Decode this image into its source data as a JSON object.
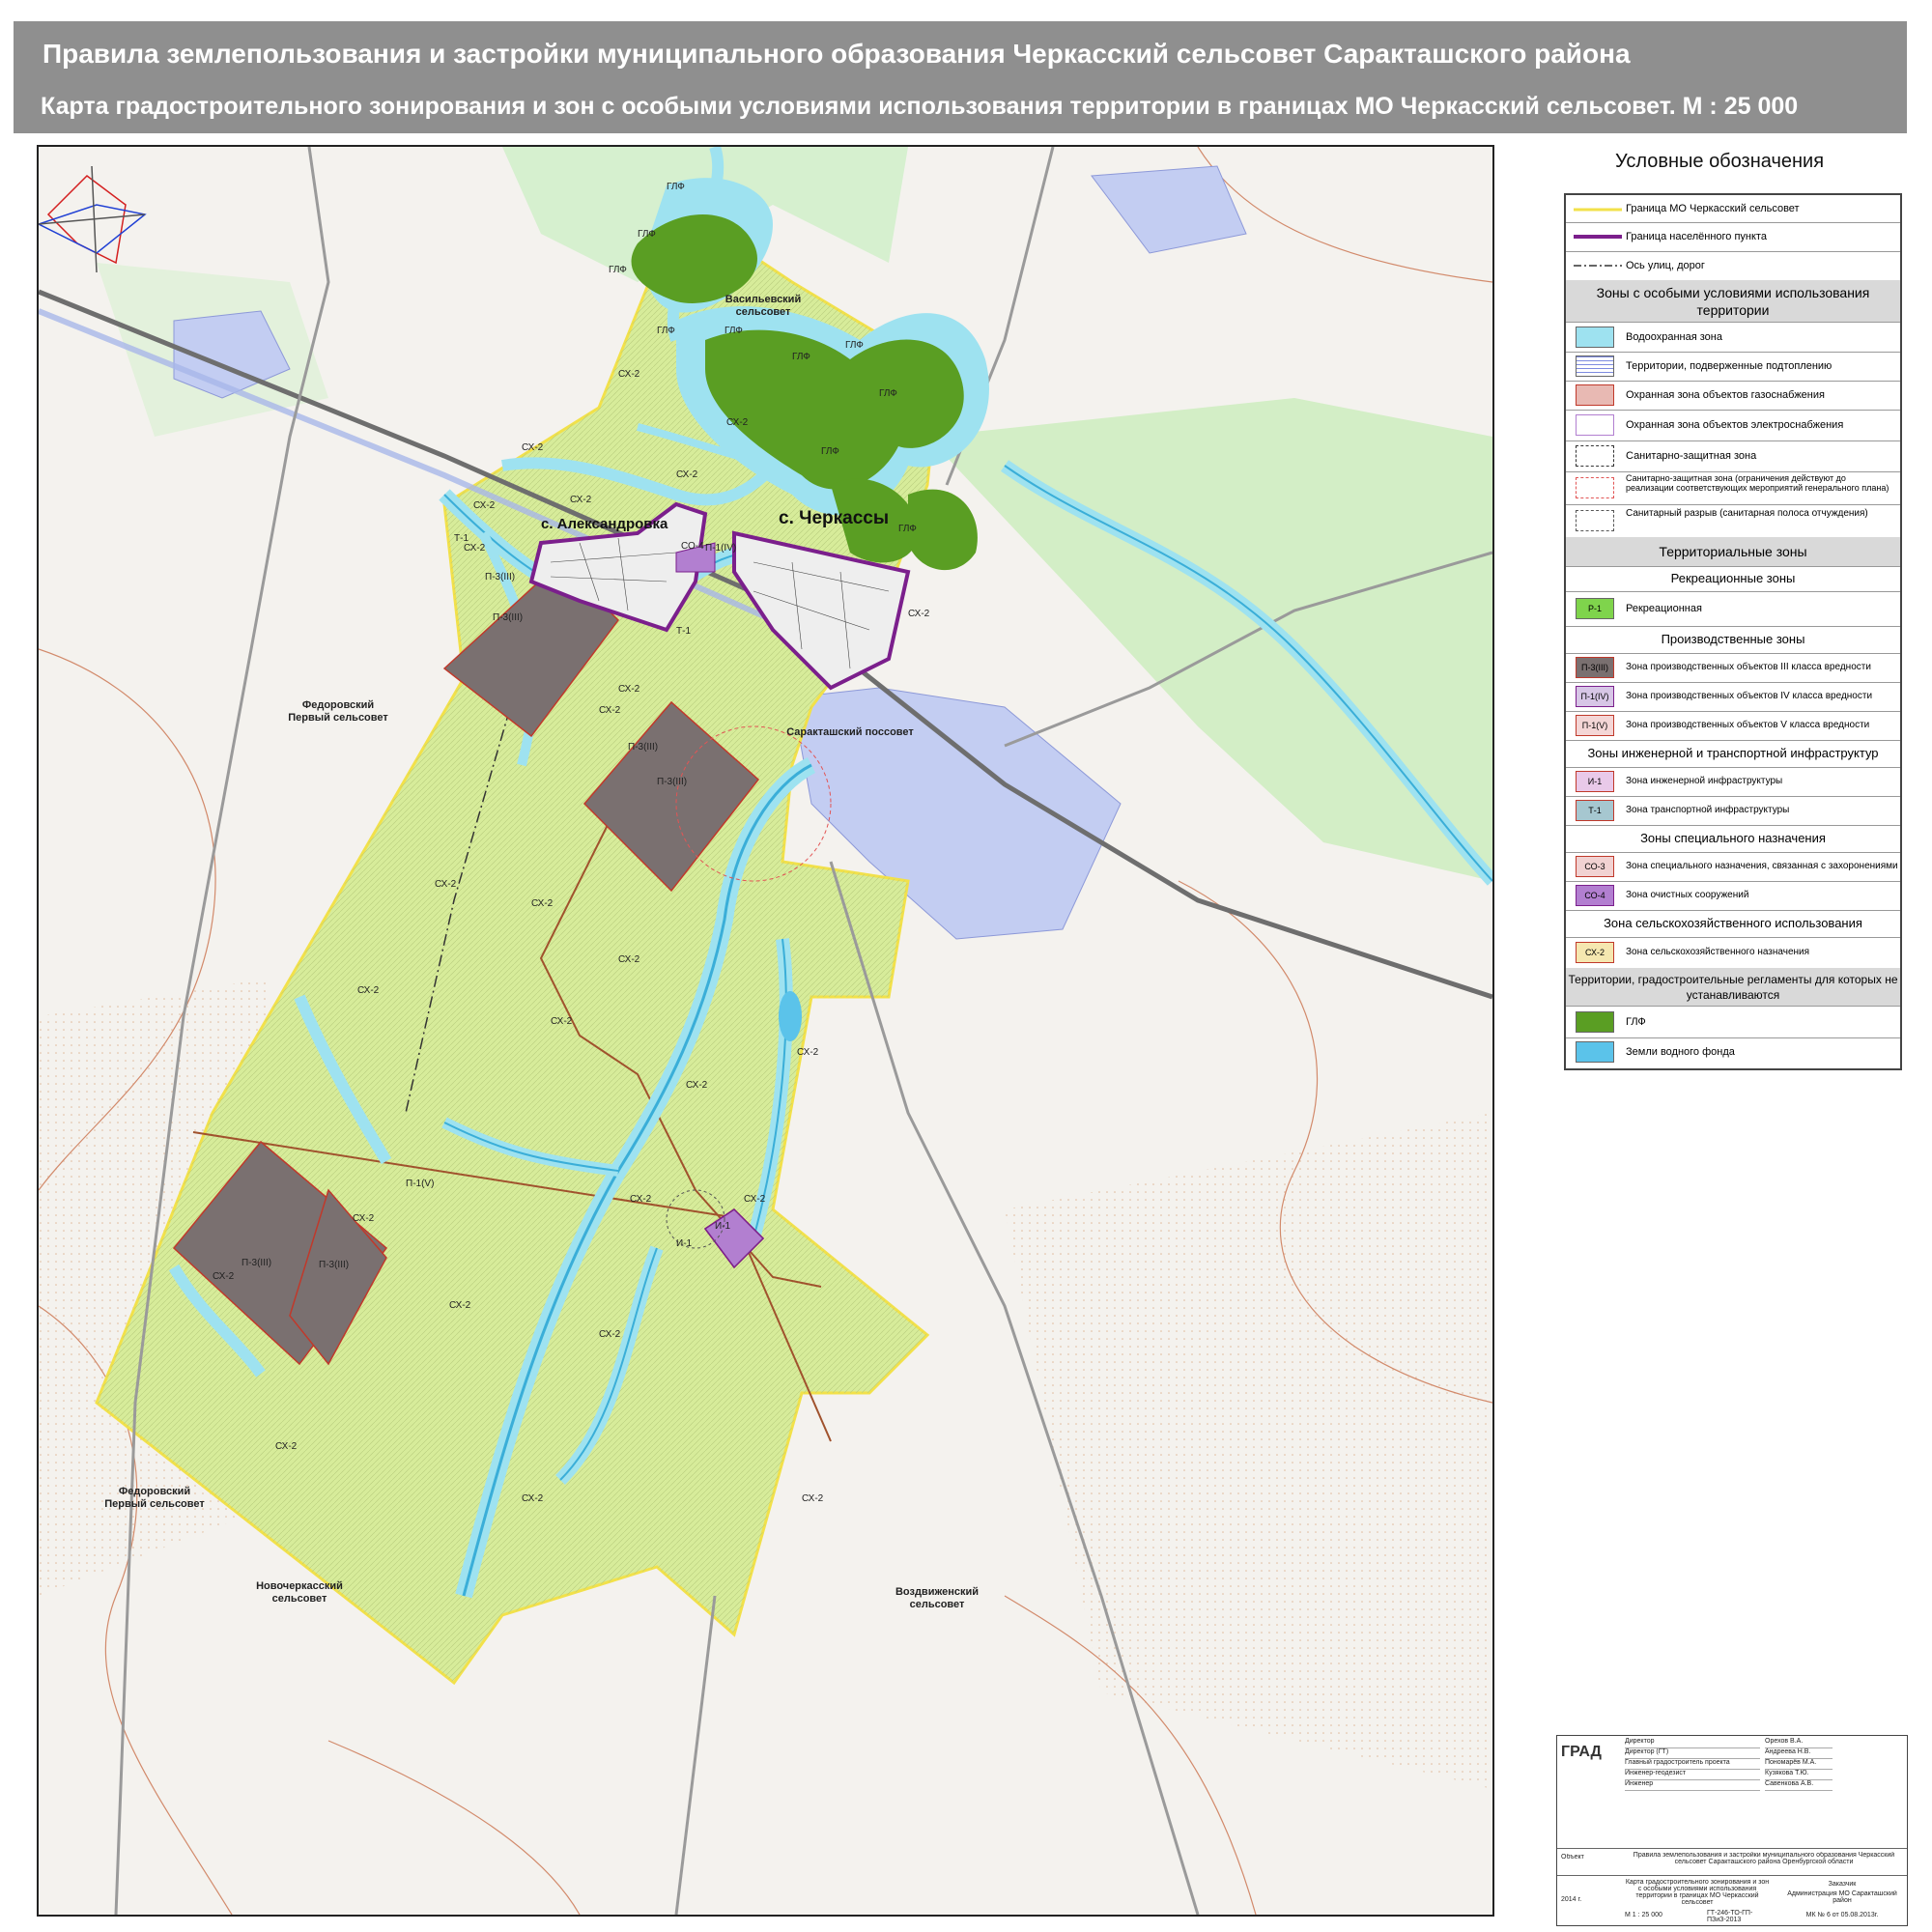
{
  "header": {
    "title": "Правила землепользования и застройки муниципального образования Черкасский сельсовет Саракташского района",
    "subtitle": "Карта градостроительного зонирования и зон с особыми условиями использования территории в границах  МО Черкасский сельсовет. М : 25 000"
  },
  "map": {
    "places": {
      "aleksandrovka": "с. Александровка",
      "cherkassy": "с. Черкассы"
    },
    "neighbors": {
      "vasilevsky": "Васильевский сельсовет",
      "fedorovsky1": "Федоровский Первый сельсовет",
      "saraktash": "Саракташский поссовет",
      "fedorovsky2": "Федоровский Первый сельсовет",
      "novocherkassky": "Новочеркасский сельсовет",
      "vozdvizhensky": "Воздвиженский сельсовет"
    },
    "zone_labels": {
      "glf": "ГЛФ",
      "sx2": "СХ-2",
      "p3": "П-3(III)",
      "p1v": "П-1(V)",
      "p1iv": "П-1(IV)",
      "t1": "Т-1",
      "i1": "И-1",
      "co4": "СО-4",
      "co3": "СО-3"
    }
  },
  "legend": {
    "title": "Условные обозначения",
    "rows": {
      "border_mo": "Граница МО Черкасский сельсовет",
      "border_settlement": "Граница населённого пункта",
      "axis_roads": "Ось улиц, дорог",
      "sec_special": "Зоны с особыми условиями использования территории",
      "water_protect": "Водоохранная зона",
      "flooding": "Территории, подверженные подтоплению",
      "gas_protect": "Охранная зона объектов газоснабжения",
      "power_protect": "Охранная зона объектов электроснабжения",
      "sanitary": "Санитарно-защитная зона",
      "sanitary_genplan": "Санитарно-защитная зона (ограничения действуют до реализации соответствующих мероприятий генерального плана)",
      "sanitary_gap": "Санитарный разрыв (санитарная полоса отчуждения)",
      "sec_territorial": "Территориальные зоны",
      "sub_recreation": "Рекреационные зоны",
      "recreation": "Рекреационная",
      "sub_production": "Производственные зоны",
      "prod3": "Зона производственных объектов  III класса вредности",
      "prod4": "Зона производственных объектов  IV класса вредности",
      "prod5": "Зона производственных объектов  V класса вредности",
      "sub_infra": "Зоны инженерной и транспортной инфраструктур",
      "eng_infra": "Зона инженерной инфраструктуры",
      "trans_infra": "Зона транспортной инфраструктуры",
      "sub_special": "Зоны специального  назначения",
      "special_burial": "Зона специального назначения, связанная с захоронениями",
      "treatment": "Зона очистных сооружений",
      "sub_agri": "Зона сельскохозяйственного использования",
      "agri": "Зона сельскохозяйственного назначения",
      "sub_noreg": "Территории, градостроительные регламенты для которых не устанавливаются",
      "glf": "ГЛФ",
      "water_fund": "Земли водного фонда"
    },
    "codes": {
      "r1": "Р-1",
      "p3": "П-3(III)",
      "p1iv": "П-1(IV)",
      "p1v": "П-1(V)",
      "i1": "И-1",
      "t1": "Т-1",
      "co3": "СО-3",
      "co4": "СО-4",
      "sx2": "СХ-2"
    },
    "colors": {
      "mo_border": "#f2e14a",
      "settlement_border": "#7b1f8c",
      "agri": "#d7ec9a",
      "production": "#7a7070",
      "glf": "#5a9e23",
      "water": "#5bc3ea",
      "water_zone": "#9ee2f0"
    }
  },
  "stamp": {
    "org": "ГРАД",
    "roles": [
      "Директор",
      "Директор (ГТ)",
      "Главный градостроитель проекта",
      "Инженер-геодезист ",
      "Инженер"
    ],
    "names": [
      "Орехов В.А.",
      "Андреева Н.В.",
      "Пономарёв М.А.",
      "Кузякова Т.Ю.",
      "Савенкова А.В."
    ],
    "object_label": "Объект",
    "object": "Правила землепользования и застройки муниципального образования Черкасский сельсовет Саракташского района Оренбургской области",
    "year": "2014 г.",
    "sheet_title": "Карта градостроительного зонирования и зон с особыми условиями использования территории в границах МО Черкасский сельсовет",
    "scale": "М 1 : 25 000",
    "code": "ГТ-246-ТО-ГП-ПЗиЗ-2013",
    "customer_label": "Заказчик",
    "customer": "Администрация МО Саракташский район",
    "contract": "МК № 6  от 05.08.2013г."
  }
}
